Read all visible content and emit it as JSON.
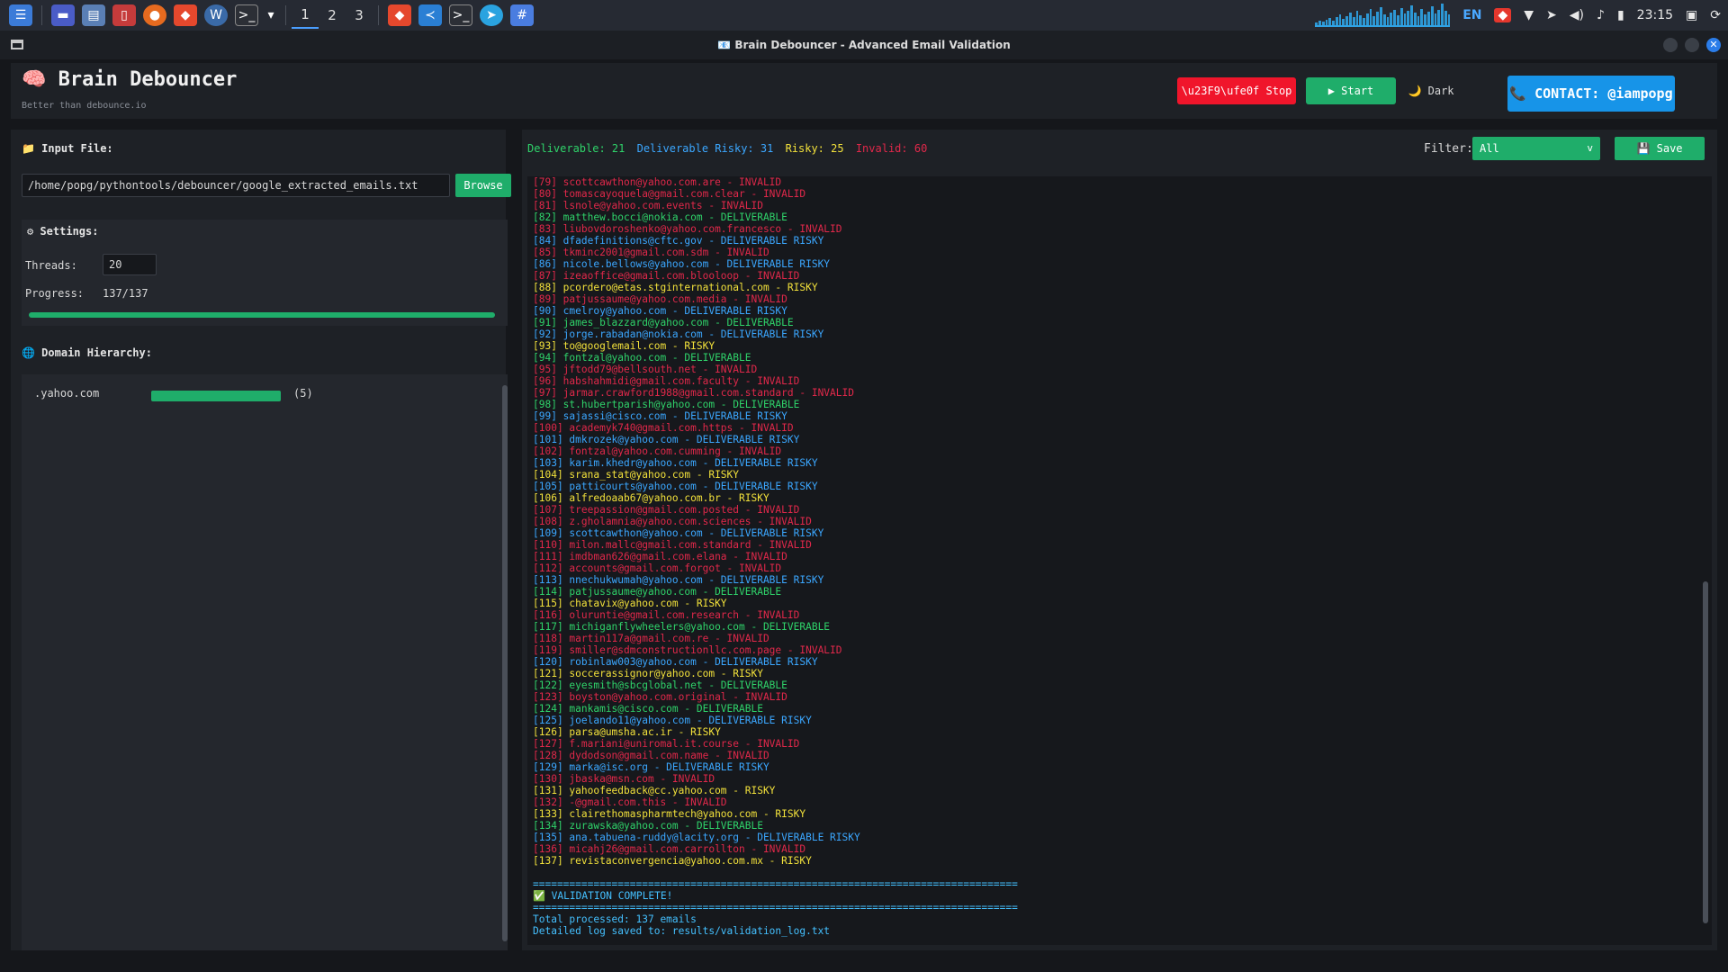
{
  "taskbar": {
    "workspaces": [
      "1",
      "2",
      "3"
    ],
    "active_workspace": 0,
    "language": "EN",
    "time": "23:15",
    "graph_levels": [
      3,
      5,
      4,
      6,
      8,
      5,
      9,
      12,
      7,
      10,
      14,
      9,
      16,
      11,
      8,
      13,
      18,
      10,
      15,
      20,
      12,
      9,
      14,
      17,
      11,
      19,
      13,
      16,
      22,
      14,
      10,
      18,
      12,
      15,
      21,
      13,
      17,
      24,
      16,
      12
    ]
  },
  "window": {
    "title": "📧 Brain Debouncer - Advanced Email Validation"
  },
  "header": {
    "title": "🧠 Brain Debouncer",
    "subtitle": "Better than debounce.io",
    "stop_label": "\\u23F9\\ufe0f Stop",
    "start_label": "▶ Start",
    "dark_label": "🌙 Dark",
    "contact_label": "📞 CONTACT: @iampopg"
  },
  "left": {
    "input_file_label": "📁 Input File:",
    "input_path": "/home/popg/pythontools/debouncer/google_extracted_emails.txt",
    "browse_label": "Browse",
    "settings_label": "⚙ Settings:",
    "threads_label": "Threads:",
    "threads_value": "20",
    "progress_label": "Progress:",
    "progress_text": "137/137",
    "progress_fraction": 1.0,
    "domain_label": "🌐 Domain Hierarchy:",
    "domains": [
      {
        "name": ".yahoo.com",
        "count_text": "(5)",
        "fraction": 1.0
      }
    ]
  },
  "right": {
    "stats": {
      "deliverable": "Deliverable: 21",
      "deliverable_risky": "Deliverable Risky: 31",
      "risky": "Risky: 25",
      "invalid": "Invalid: 60"
    },
    "filter_label": "Filter:",
    "filter_value": "All",
    "save_label": "💾 Save",
    "log": [
      {
        "n": "[79]",
        "email": "scottcawthon@yahoo.com.are",
        "status": "INVALID"
      },
      {
        "n": "[80]",
        "email": "tomascayoquela@gmail.com.clear",
        "status": "INVALID"
      },
      {
        "n": "[81]",
        "email": "lsnole@yahoo.com.events",
        "status": "INVALID"
      },
      {
        "n": "[82]",
        "email": "matthew.bocci@nokia.com",
        "status": "DELIVERABLE"
      },
      {
        "n": "[83]",
        "email": "liubovdoroshenko@yahoo.com.francesco",
        "status": "INVALID"
      },
      {
        "n": "[84]",
        "email": "dfadefinitions@cftc.gov",
        "status": "DELIVERABLE RISKY"
      },
      {
        "n": "[85]",
        "email": "tkminc2001@gmail.com.sdm",
        "status": "INVALID"
      },
      {
        "n": "[86]",
        "email": "nicole.bellows@yahoo.com",
        "status": "DELIVERABLE RISKY"
      },
      {
        "n": "[87]",
        "email": "izeaoffice@gmail.com.blooloop",
        "status": "INVALID"
      },
      {
        "n": "[88]",
        "email": "pcordero@etas.stginternational.com",
        "status": "RISKY"
      },
      {
        "n": "[89]",
        "email": "patjussaume@yahoo.com.media",
        "status": "INVALID"
      },
      {
        "n": "[90]",
        "email": "cmelroy@yahoo.com",
        "status": "DELIVERABLE RISKY"
      },
      {
        "n": "[91]",
        "email": "james_blazzard@yahoo.com",
        "status": "DELIVERABLE"
      },
      {
        "n": "[92]",
        "email": "jorge.rabadan@nokia.com",
        "status": "DELIVERABLE RISKY"
      },
      {
        "n": "[93]",
        "email": "to@googlemail.com",
        "status": "RISKY"
      },
      {
        "n": "[94]",
        "email": "fontzal@yahoo.com",
        "status": "DELIVERABLE"
      },
      {
        "n": "[95]",
        "email": "jftodd79@bellsouth.net",
        "status": "INVALID"
      },
      {
        "n": "[96]",
        "email": "habshahmidi@gmail.com.faculty",
        "status": "INVALID"
      },
      {
        "n": "[97]",
        "email": "jarmar.crawford1988@gmail.com.standard",
        "status": "INVALID"
      },
      {
        "n": "[98]",
        "email": "st.hubertparish@yahoo.com",
        "status": "DELIVERABLE"
      },
      {
        "n": "[99]",
        "email": "sajassi@cisco.com",
        "status": "DELIVERABLE RISKY"
      },
      {
        "n": "[100]",
        "email": "academyk740@gmail.com.https",
        "status": "INVALID"
      },
      {
        "n": "[101]",
        "email": "dmkrozek@yahoo.com",
        "status": "DELIVERABLE RISKY"
      },
      {
        "n": "[102]",
        "email": "fontzal@yahoo.com.cumming",
        "status": "INVALID"
      },
      {
        "n": "[103]",
        "email": "karim.khedr@yahoo.com",
        "status": "DELIVERABLE RISKY"
      },
      {
        "n": "[104]",
        "email": "srana_stat@yahoo.com",
        "status": "RISKY"
      },
      {
        "n": "[105]",
        "email": "patticourts@yahoo.com",
        "status": "DELIVERABLE RISKY"
      },
      {
        "n": "[106]",
        "email": "alfredoaab67@yahoo.com.br",
        "status": "RISKY"
      },
      {
        "n": "[107]",
        "email": "treepassion@gmail.com.posted",
        "status": "INVALID"
      },
      {
        "n": "[108]",
        "email": "z.gholamnia@yahoo.com.sciences",
        "status": "INVALID"
      },
      {
        "n": "[109]",
        "email": "scottcawthon@yahoo.com",
        "status": "DELIVERABLE RISKY"
      },
      {
        "n": "[110]",
        "email": "milon.mallc@gmail.com.standard",
        "status": "INVALID"
      },
      {
        "n": "[111]",
        "email": "imdbman626@gmail.com.elana",
        "status": "INVALID"
      },
      {
        "n": "[112]",
        "email": "accounts@gmail.com.forgot",
        "status": "INVALID"
      },
      {
        "n": "[113]",
        "email": "nnechukwumah@yahoo.com",
        "status": "DELIVERABLE RISKY"
      },
      {
        "n": "[114]",
        "email": "patjussaume@yahoo.com",
        "status": "DELIVERABLE"
      },
      {
        "n": "[115]",
        "email": "chatavix@yahoo.com",
        "status": "RISKY"
      },
      {
        "n": "[116]",
        "email": "oluruntie@gmail.com.research",
        "status": "INVALID"
      },
      {
        "n": "[117]",
        "email": "michiganflywheelers@yahoo.com",
        "status": "DELIVERABLE"
      },
      {
        "n": "[118]",
        "email": "martin117a@gmail.com.re",
        "status": "INVALID"
      },
      {
        "n": "[119]",
        "email": "smiller@sdmconstructionllc.com.page",
        "status": "INVALID"
      },
      {
        "n": "[120]",
        "email": "robinlaw003@yahoo.com",
        "status": "DELIVERABLE RISKY"
      },
      {
        "n": "[121]",
        "email": "soccerassignor@yahoo.com",
        "status": "RISKY"
      },
      {
        "n": "[122]",
        "email": "eyesmith@sbcglobal.net",
        "status": "DELIVERABLE"
      },
      {
        "n": "[123]",
        "email": "boyston@yahoo.com.original",
        "status": "INVALID"
      },
      {
        "n": "[124]",
        "email": "mankamis@cisco.com",
        "status": "DELIVERABLE"
      },
      {
        "n": "[125]",
        "email": "joelando11@yahoo.com",
        "status": "DELIVERABLE RISKY"
      },
      {
        "n": "[126]",
        "email": "parsa@umsha.ac.ir",
        "status": "RISKY"
      },
      {
        "n": "[127]",
        "email": "f.mariani@uniromal.it.course",
        "status": "INVALID"
      },
      {
        "n": "[128]",
        "email": "dydodson@gmail.com.name",
        "status": "INVALID"
      },
      {
        "n": "[129]",
        "email": "marka@isc.org",
        "status": "DELIVERABLE RISKY"
      },
      {
        "n": "[130]",
        "email": "jbaska@msn.com",
        "status": "INVALID"
      },
      {
        "n": "[131]",
        "email": "yahoofeedback@cc.yahoo.com",
        "status": "RISKY"
      },
      {
        "n": "[132]",
        "email": "-@gmail.com.this",
        "status": "INVALID"
      },
      {
        "n": "[133]",
        "email": "clairethomaspharmtech@yahoo.com",
        "status": "RISKY"
      },
      {
        "n": "[134]",
        "email": "zurawska@yahoo.com",
        "status": "DELIVERABLE"
      },
      {
        "n": "[135]",
        "email": "ana.tabuena-ruddy@lacity.org",
        "status": "DELIVERABLE RISKY"
      },
      {
        "n": "[136]",
        "email": "micahj26@gmail.com.carrollton",
        "status": "INVALID"
      },
      {
        "n": "[137]",
        "email": "revistaconvergencia@yahoo.com.mx",
        "status": "RISKY"
      }
    ],
    "footer": {
      "separator": "================================================================================",
      "complete": "✅ VALIDATION COMPLETE!",
      "total": "Total processed: 137 emails",
      "saved": "Detailed log saved to: results/validation_log.txt"
    }
  },
  "colors": {
    "green": "#1fad6a",
    "red": "#f0152b",
    "blue": "#1794e8",
    "invalid": "#e0284a",
    "deliverable": "#2fd36a",
    "deliverable_risky": "#3ba7ff",
    "risky": "#f2e13b"
  }
}
